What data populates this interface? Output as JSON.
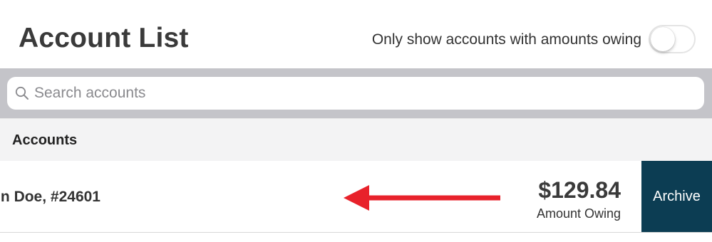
{
  "header": {
    "title": "Account List",
    "toggle_label": "Only show accounts with amounts owing",
    "toggle_on": false
  },
  "search": {
    "placeholder": "Search accounts",
    "value": ""
  },
  "section": {
    "title": "Accounts"
  },
  "accounts": [
    {
      "name": "n Doe, #24601",
      "amount": "$129.84",
      "amount_label": "Amount Owing",
      "action_label": "Archive"
    }
  ],
  "colors": {
    "archive_bg": "#0c3d53",
    "search_bar_bg": "#c4c4c9",
    "section_bg": "#f3f3f4",
    "arrow": "#e8222b"
  },
  "icons": {
    "search": "search-icon",
    "arrow": "arrow-left-icon"
  }
}
